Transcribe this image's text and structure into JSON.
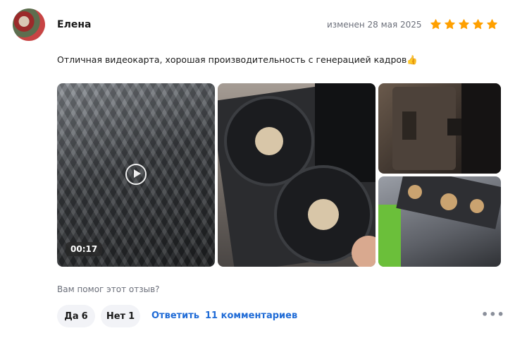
{
  "review": {
    "author": "Елена",
    "edited": "изменен 28 мая 2025",
    "rating": 5,
    "rating_max": 5,
    "star_color": "#ffa000",
    "text": "Отличная видеокарта, хорошая производительность с генерацией кадров👍",
    "video_duration": "00:17"
  },
  "footer": {
    "helpful_question": "Вам помог этот отзыв?",
    "yes_label": "Да",
    "yes_count": "6",
    "no_label": "Нет",
    "no_count": "1",
    "reply_label": "Ответить",
    "comments_label": "11 комментариев",
    "more_icon": "more-horizontal-icon"
  },
  "colors": {
    "link": "#1f6bd6",
    "muted": "#6b6f7a",
    "pill_bg": "#f2f3f7"
  }
}
